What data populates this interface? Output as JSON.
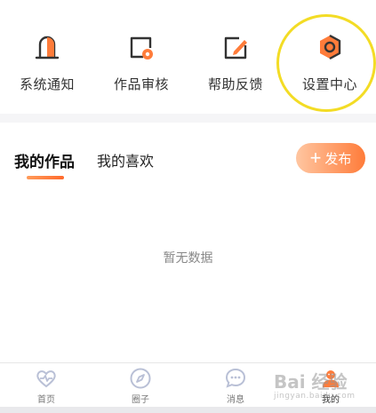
{
  "top_menu": {
    "items": [
      {
        "label": "系统通知",
        "icon": "bell-icon"
      },
      {
        "label": "作品审核",
        "icon": "review-icon"
      },
      {
        "label": "帮助反馈",
        "icon": "edit-feedback-icon"
      },
      {
        "label": "设置中心",
        "icon": "gear-icon"
      }
    ]
  },
  "works": {
    "tabs": [
      {
        "label": "我的作品",
        "active": true
      },
      {
        "label": "我的喜欢",
        "active": false
      }
    ],
    "publish_label": "发布",
    "publish_symbol": "+",
    "empty_text": "暂无数据"
  },
  "tabbar": {
    "items": [
      {
        "label": "首页",
        "icon": "heart-pulse-icon"
      },
      {
        "label": "圈子",
        "icon": "compass-icon"
      },
      {
        "label": "消息",
        "icon": "chat-bubble-icon"
      },
      {
        "label": "我的",
        "icon": "user-icon"
      }
    ]
  },
  "watermark": {
    "text": "Bai 经验",
    "sub": "jingyan.baidu.com"
  },
  "colors": {
    "accent": "#ff7c3a",
    "accent_light": "#ffc6a1",
    "highlight": "#f3dc25",
    "icon_stroke": "#333333",
    "tab_inactive": "#b9c0d6"
  }
}
